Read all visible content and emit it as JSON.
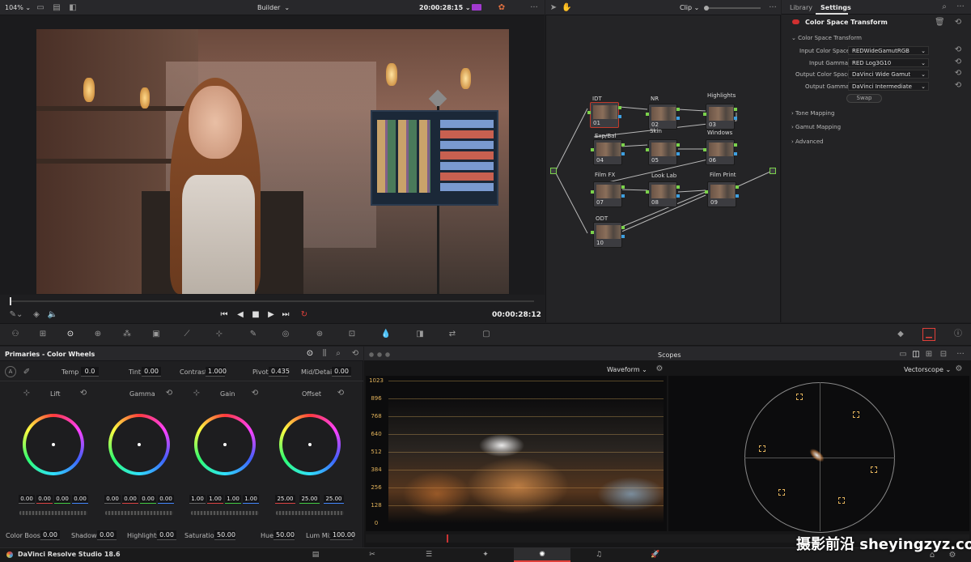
{
  "viewer": {
    "zoom": "104%",
    "mode": "Builder",
    "timecode_top": "20:00:28:15",
    "timecode_bottom": "00:00:28:12"
  },
  "node_editor": {
    "mode": "Clip",
    "nodes": [
      {
        "label": "IDT",
        "num": "01"
      },
      {
        "label": "NR",
        "num": "02"
      },
      {
        "label": "Highlights",
        "num": "03"
      },
      {
        "label": "Exp/Bal",
        "num": "04"
      },
      {
        "label": "Skin",
        "num": "05"
      },
      {
        "label": "Windows",
        "num": "06"
      },
      {
        "label": "Film FX",
        "num": "07"
      },
      {
        "label": "Look Lab",
        "num": "08"
      },
      {
        "label": "Film Print",
        "num": "09"
      },
      {
        "label": "ODT",
        "num": "10"
      }
    ]
  },
  "settings_panel": {
    "tabs": [
      "Library",
      "Settings"
    ],
    "title": "Color Space Transform",
    "section": "Color Space Transform",
    "rows": [
      {
        "label": "Input Color Space",
        "value": "REDWideGamutRGB"
      },
      {
        "label": "Input Gamma",
        "value": "RED Log3G10"
      },
      {
        "label": "Output Color Space",
        "value": "DaVinci Wide Gamut"
      },
      {
        "label": "Output Gamma",
        "value": "DaVinci Intermediate"
      }
    ],
    "swap": "Swap",
    "collapsed": [
      "Tone Mapping",
      "Gamut Mapping",
      "Advanced"
    ]
  },
  "primaries": {
    "title": "Primaries - Color Wheels",
    "top": {
      "temp_label": "Temp",
      "temp": "0.0",
      "tint_label": "Tint",
      "tint": "0.00",
      "contrast_label": "Contrast",
      "contrast": "1.000",
      "pivot_label": "Pivot",
      "pivot": "0.435",
      "middetail_label": "Mid/Detail",
      "middetail": "0.00"
    },
    "wheels": [
      {
        "name": "Lift",
        "values": [
          "0.00",
          "0.00",
          "0.00",
          "0.00"
        ]
      },
      {
        "name": "Gamma",
        "values": [
          "0.00",
          "0.00",
          "0.00",
          "0.00"
        ]
      },
      {
        "name": "Gain",
        "values": [
          "1.00",
          "1.00",
          "1.00",
          "1.00"
        ]
      },
      {
        "name": "Offset",
        "values": [
          "25.00",
          "25.00",
          "25.00"
        ]
      }
    ],
    "bottom": {
      "colorboost_label": "Color Boost",
      "colorboost": "0.00",
      "shadows_label": "Shadows",
      "shadows": "0.00",
      "highlights_label": "Highlights",
      "highlights": "0.00",
      "saturation_label": "Saturation",
      "saturation": "50.00",
      "hue_label": "Hue",
      "hue": "50.00",
      "lummix_label": "Lum Mix",
      "lummix": "100.00"
    }
  },
  "scopes": {
    "title": "Scopes",
    "left": "Waveform",
    "right": "Vectorscope",
    "yaxis": [
      "1023",
      "896",
      "768",
      "640",
      "512",
      "384",
      "256",
      "128",
      "0"
    ]
  },
  "footer": {
    "app": "DaVinci Resolve Studio 18.6",
    "watermark": "摄影前沿 sheyingzyz.com"
  }
}
